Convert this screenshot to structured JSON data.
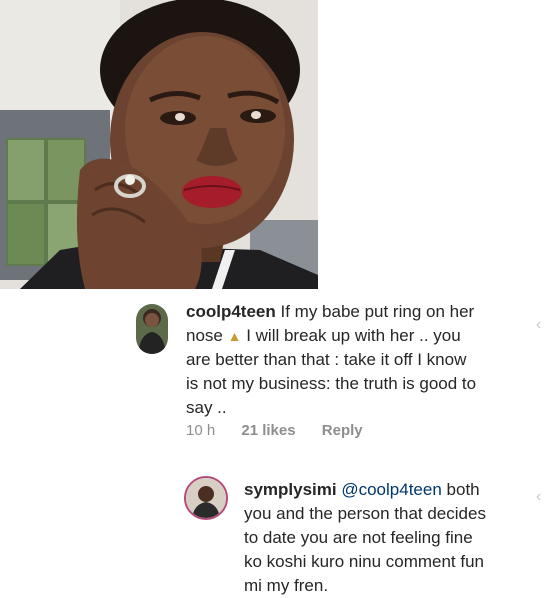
{
  "photo": {
    "alt_icon": "profile-photo"
  },
  "comment1": {
    "username": "coolp4teen",
    "lines": [
      "If my babe put ring on her",
      "nose",
      "I will break up with her .. you",
      "are better than that : take it off I know",
      "is not my business: the truth is good to",
      "say .."
    ],
    "emoji_icon": "praying-hands-icon",
    "time": "10 h",
    "likes": "21 likes",
    "reply": "Reply"
  },
  "comment2": {
    "username": "symplysimi",
    "mention": "@coolp4teen",
    "lines": [
      "both",
      "you and the person that decides",
      "to date you are not feeling fine",
      "ko koshi kuro ninu comment fun",
      "mi my fren."
    ]
  },
  "colors": {
    "text": "#262626",
    "meta": "#8e8e8e",
    "mention": "#00376b"
  }
}
